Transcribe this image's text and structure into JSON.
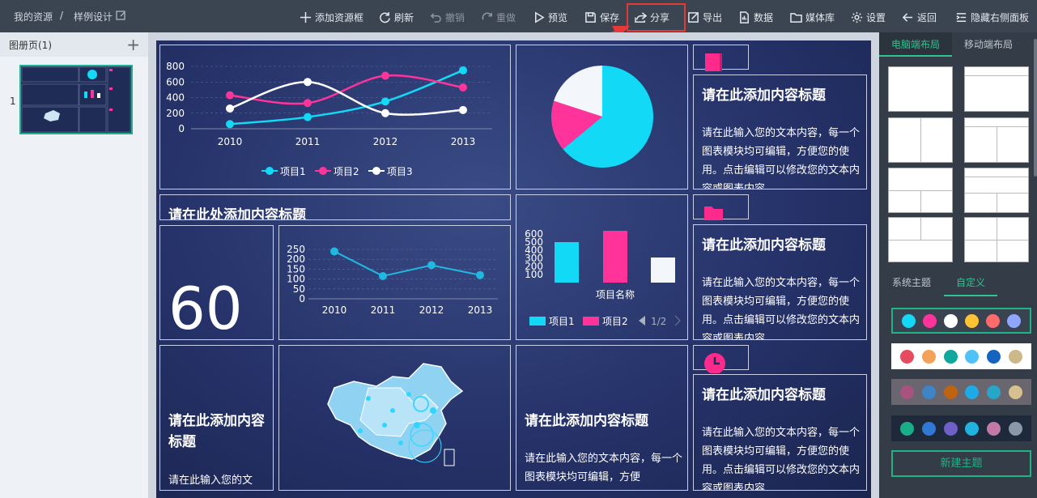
{
  "breadcrumb": {
    "root": "我的资源",
    "sep": "/",
    "current": "样例设计"
  },
  "toolbar": {
    "add_frame": "添加资源框",
    "refresh": "刷新",
    "undo": "撤销",
    "redo": "重做",
    "preview": "预览",
    "save": "保存",
    "share": "分享",
    "export": "导出",
    "data": "数据",
    "media": "媒体库",
    "settings": "设置",
    "back": "返回",
    "hide_right": "隐藏右侧面板"
  },
  "left_panel": {
    "title": "图册页(1)",
    "page_number": "1"
  },
  "canvas": {
    "line_chart_1": {
      "y_ticks": [
        "800",
        "600",
        "400",
        "200",
        "0"
      ],
      "x_ticks": [
        "2010",
        "2011",
        "2012",
        "2013"
      ],
      "legend": [
        "项目1",
        "项目2",
        "项目3"
      ]
    },
    "title_strip": "请在此处添加内容标题",
    "big_number": "60",
    "line_chart_2": {
      "y_ticks": [
        "250",
        "200",
        "150",
        "100",
        "50",
        "0"
      ],
      "x_ticks": [
        "2010",
        "2011",
        "2012",
        "2013"
      ]
    },
    "bar_chart": {
      "y_ticks": [
        "600",
        "500",
        "400",
        "300",
        "200",
        "100"
      ],
      "xlabel": "项目名称",
      "legend": [
        "项目1",
        "项目2"
      ],
      "pager": "1/2"
    },
    "text_block_1": {
      "title": "请在此添加内容标题",
      "body": "请在此输入您的文本内容，每一个图表模块均可编辑，方便您的使用。点击编辑可以修改您的文本内容或图表内容"
    },
    "text_block_2": {
      "title": "请在此添加内容标题",
      "body": "请在此输入您的文本内容，每一个图表模块均可编辑，方便您的使用。点击编辑可以修改您的文本内容或图表内容"
    },
    "text_block_3": {
      "title": "请在此添加内容标题",
      "body": "请在此输入您的文本内容，每一个图表模块均可编辑，方便您的使用。点击编辑可以修改您的文本内容或图表内容"
    },
    "left_text": {
      "title": "请在此添加内容标题",
      "body": "请在此输入您的文"
    },
    "mid_text": {
      "title": "请在此添加内容标题",
      "body": "请在此输入您的文本内容，每一个图表模块均可编辑，方便"
    }
  },
  "right_panel": {
    "tabs": [
      "电脑端布局",
      "移动端布局"
    ],
    "theme_tabs": [
      "系统主题",
      "自定义"
    ],
    "new_theme": "新建主题",
    "palettes": [
      [
        "#12d9f5",
        "#ff3399",
        "#ffffff",
        "#ffc233",
        "#ff6b6b",
        "#8fa6ff"
      ],
      [
        "#e84a5f",
        "#f4a259",
        "#10a89c",
        "#4fc3f7",
        "#1565c0",
        "#cdb88a"
      ],
      [
        "#a8537f",
        "#3d85c6",
        "#c0630f",
        "#1eaae7",
        "#28a6c9",
        "#d5c08e"
      ],
      [
        "#1aae88",
        "#2f78d6",
        "#6f5fc8",
        "#22b2e0",
        "#c279a6",
        "#8a97ab"
      ]
    ]
  },
  "chart_data": [
    {
      "type": "line",
      "x": [
        "2010",
        "2011",
        "2012",
        "2013"
      ],
      "series": [
        {
          "name": "项目1",
          "values": [
            60,
            150,
            350,
            750
          ],
          "color": "#12d9f5"
        },
        {
          "name": "项目2",
          "values": [
            430,
            330,
            680,
            530
          ],
          "color": "#ff3399"
        },
        {
          "name": "项目3",
          "values": [
            260,
            600,
            200,
            240
          ],
          "color": "#ffffff"
        }
      ],
      "ylim": [
        0,
        800
      ]
    },
    {
      "type": "pie",
      "slices": [
        {
          "value": 64,
          "color": "#12d9f5"
        },
        {
          "value": 16,
          "color": "#ff3399"
        },
        {
          "value": 20,
          "color": "#f3f6fb"
        }
      ]
    },
    {
      "type": "line",
      "x": [
        "2010",
        "2011",
        "2012",
        "2013"
      ],
      "series": [
        {
          "values": [
            240,
            115,
            170,
            120
          ],
          "color": "#20b8e0"
        }
      ],
      "ylim": [
        0,
        250
      ]
    },
    {
      "type": "bar",
      "categories": [
        "项目名称"
      ],
      "series": [
        {
          "name": "项目1",
          "values": [
            500
          ],
          "color": "#12d9f5"
        },
        {
          "name": "项目2",
          "values": [
            640
          ],
          "color": "#ff3399"
        },
        {
          "values": [
            310
          ],
          "color": "#f3f6fb"
        }
      ],
      "xlabel": "项目名称",
      "ylim": [
        0,
        600
      ]
    }
  ]
}
